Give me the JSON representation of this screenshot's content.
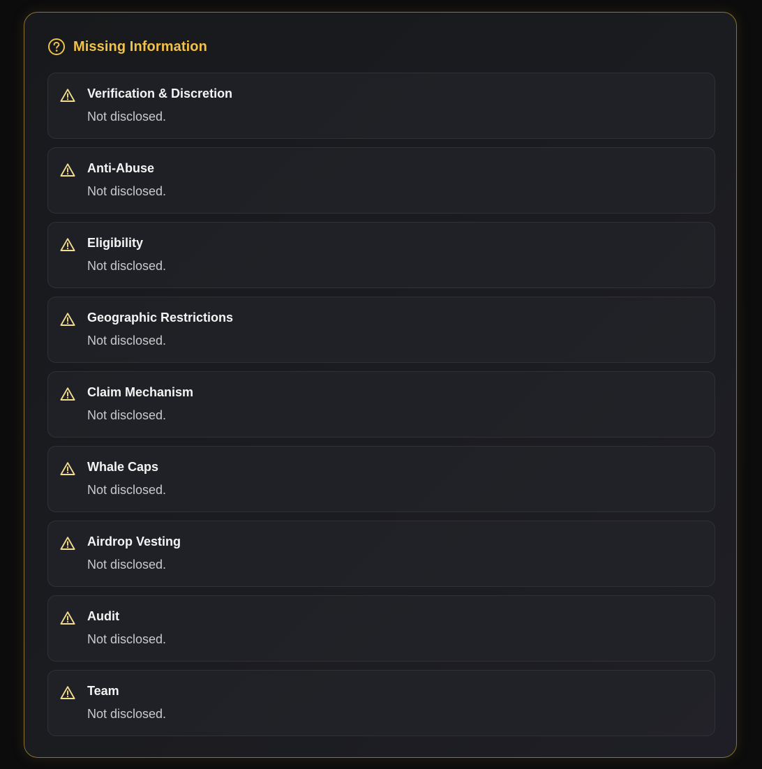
{
  "section": {
    "title": "Missing Information",
    "icon": "help-circle-icon",
    "accent_color": "#f0c14b"
  },
  "items": [
    {
      "label": "Verification & Discretion",
      "value": "Not disclosed.",
      "icon": "warning-triangle-icon"
    },
    {
      "label": "Anti-Abuse",
      "value": "Not disclosed.",
      "icon": "warning-triangle-icon"
    },
    {
      "label": "Eligibility",
      "value": "Not disclosed.",
      "icon": "warning-triangle-icon"
    },
    {
      "label": "Geographic Restrictions",
      "value": "Not disclosed.",
      "icon": "warning-triangle-icon"
    },
    {
      "label": "Claim Mechanism",
      "value": "Not disclosed.",
      "icon": "warning-triangle-icon"
    },
    {
      "label": "Whale Caps",
      "value": "Not disclosed.",
      "icon": "warning-triangle-icon"
    },
    {
      "label": "Airdrop Vesting",
      "value": "Not disclosed.",
      "icon": "warning-triangle-icon"
    },
    {
      "label": "Audit",
      "value": "Not disclosed.",
      "icon": "warning-triangle-icon"
    },
    {
      "label": "Team",
      "value": "Not disclosed.",
      "icon": "warning-triangle-icon"
    }
  ]
}
